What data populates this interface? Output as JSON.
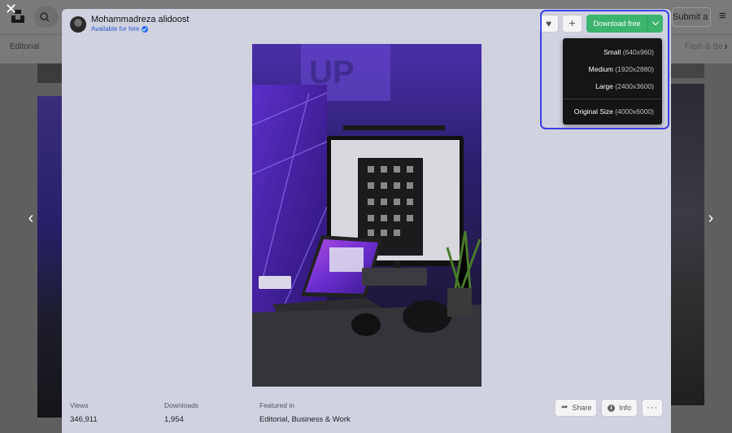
{
  "background": {
    "submit_label": "Submit a photo",
    "topic_editorial": "Editorial",
    "topic_right": "Fash & Be",
    "menu_icon": "hamburger-icon"
  },
  "modal": {
    "author": {
      "name": "Mohammadreza alidoost",
      "hire_label": "Available for hire"
    },
    "actions": {
      "like_icon": "heart-icon",
      "add_icon": "plus-icon",
      "download_label": "Download free"
    },
    "download_menu": {
      "items": [
        {
          "size": "Small",
          "dims": "(640x960)"
        },
        {
          "size": "Medium",
          "dims": "(1920x2880)"
        },
        {
          "size": "Large",
          "dims": "(2400x3600)"
        },
        {
          "size": "Original Size",
          "dims": "(4000x6000)"
        }
      ]
    },
    "stats": {
      "views_label": "Views",
      "views_value": "346,911",
      "downloads_label": "Downloads",
      "downloads_value": "1,954",
      "featured_label": "Featured in",
      "featured_value": "Editorial, Business & Work"
    },
    "footer": {
      "share_label": "Share",
      "info_label": "Info",
      "more_label": "···"
    }
  },
  "colors": {
    "accent_green": "#3cb46e",
    "highlight_blue": "#3b3fe6",
    "modal_bg": "#d0d2e0",
    "dropdown_bg": "#151515"
  }
}
